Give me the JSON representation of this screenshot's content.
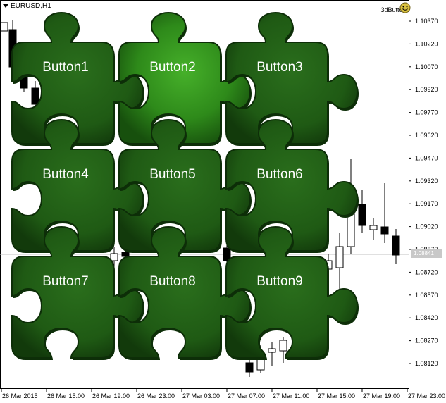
{
  "chart_header": {
    "symbol": "EURUSD,H1",
    "expert_name": "3dButtons",
    "expert_icon": "smiley-icon"
  },
  "price_axis": {
    "labels": [
      "1.10370",
      "1.10220",
      "1.10070",
      "1.09920",
      "1.09770",
      "1.09620",
      "1.09470",
      "1.09320",
      "1.09170",
      "1.09020",
      "1.08870",
      "1.08720",
      "1.08570",
      "1.08420",
      "1.08270",
      "1.08120"
    ],
    "current_price": "1.08841"
  },
  "time_axis": {
    "labels": [
      "26 Mar 2015",
      "26 Mar 15:00",
      "26 Mar 19:00",
      "26 Mar 23:00",
      "27 Mar 03:00",
      "27 Mar 07:00",
      "27 Mar 11:00",
      "27 Mar 15:00",
      "27 Mar 19:00",
      "27 Mar 23:00"
    ]
  },
  "buttons": [
    {
      "label": "Button1",
      "state": "normal"
    },
    {
      "label": "Button2",
      "state": "highlighted"
    },
    {
      "label": "Button3",
      "state": "normal"
    },
    {
      "label": "Button4",
      "state": "normal"
    },
    {
      "label": "Button5",
      "state": "normal"
    },
    {
      "label": "Button6",
      "state": "normal"
    },
    {
      "label": "Button7",
      "state": "normal"
    },
    {
      "label": "Button8",
      "state": "normal"
    },
    {
      "label": "Button9",
      "state": "normal"
    }
  ],
  "colors": {
    "puzzle_normal": "#1f5a14",
    "puzzle_highlight": "#3a9a22",
    "puzzle_edge": "#0d2e08"
  }
}
